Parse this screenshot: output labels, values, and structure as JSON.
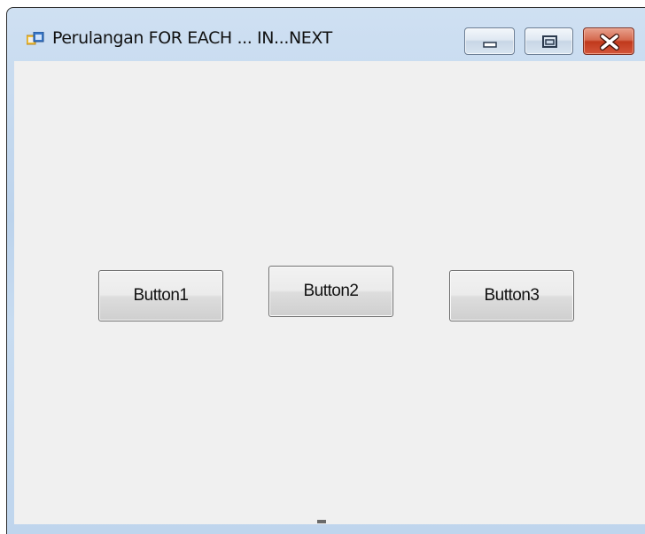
{
  "window": {
    "title": "Perulangan FOR EACH ... IN...NEXT",
    "controls": {
      "minimize_icon": "minimize-icon",
      "maximize_icon": "maximize-icon",
      "close_icon": "close-icon"
    }
  },
  "form": {
    "buttons": [
      {
        "label": "Button1"
      },
      {
        "label": "Button2"
      },
      {
        "label": "Button3"
      }
    ]
  },
  "colors": {
    "client_background": "#f0f0f0",
    "close_button": "#c0391c",
    "title_frame": "#c2d7ee"
  }
}
